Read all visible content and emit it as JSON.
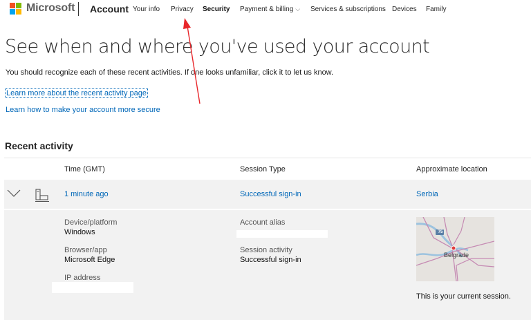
{
  "header": {
    "brand": "Microsoft",
    "section": "Account",
    "nav": [
      {
        "label": "Your info",
        "active": false
      },
      {
        "label": "Privacy",
        "active": false
      },
      {
        "label": "Security",
        "active": true
      },
      {
        "label": "Payment & billing",
        "active": false,
        "dropdown": true
      },
      {
        "label": "Services & subscriptions",
        "active": false
      },
      {
        "label": "Devices",
        "active": false
      },
      {
        "label": "Family",
        "active": false
      }
    ],
    "dropdown_caret": "⌵"
  },
  "page": {
    "title": "See when and where you've used your account",
    "lead": "You should recognize each of these recent activities. If one looks unfamiliar, click it to let us know.",
    "link_recent_activity": "Learn more about the recent activity page",
    "link_secure": "Learn how to make your account more secure",
    "section_title": "Recent activity"
  },
  "table": {
    "headers": {
      "time": "Time (GMT)",
      "session_type": "Session Type",
      "location": "Approximate location"
    },
    "row": {
      "time": "1 minute ago",
      "session_type": "Successful sign-in",
      "location": "Serbia",
      "device_icon": "computer-icon",
      "expand_icon": "chevron-down-icon"
    },
    "detail": {
      "device_label": "Device/platform",
      "device_value": "Windows",
      "browser_label": "Browser/app",
      "browser_value": "Microsoft Edge",
      "ip_label": "IP address",
      "alias_label": "Account alias",
      "activity_label": "Session activity",
      "activity_value": "Successful sign-in",
      "map_city": "Belgrade",
      "map_road": "75",
      "current_session_note": "This is your current session."
    }
  },
  "colors": {
    "link": "#0067b8",
    "row_bg": "#f2f2f2",
    "annotation_arrow": "#e8262a"
  }
}
